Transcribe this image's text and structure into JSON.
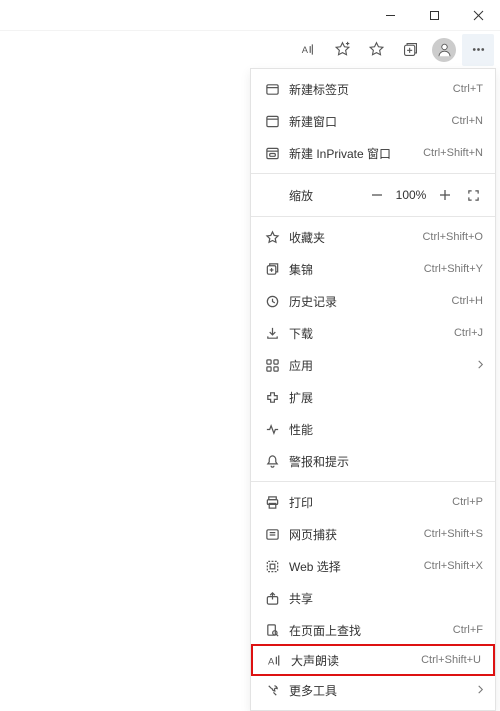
{
  "window": {
    "minimize": "–",
    "maximize": "□",
    "close": "×"
  },
  "menu": {
    "newTab": {
      "label": "新建标签页",
      "shortcut": "Ctrl+T"
    },
    "newWindow": {
      "label": "新建窗口",
      "shortcut": "Ctrl+N"
    },
    "newInPrivate": {
      "label": "新建 InPrivate 窗口",
      "shortcut": "Ctrl+Shift+N"
    },
    "zoom": {
      "label": "缩放",
      "value": "100%"
    },
    "favorites": {
      "label": "收藏夹",
      "shortcut": "Ctrl+Shift+O"
    },
    "collections": {
      "label": "集锦",
      "shortcut": "Ctrl+Shift+Y"
    },
    "history": {
      "label": "历史记录",
      "shortcut": "Ctrl+H"
    },
    "downloads": {
      "label": "下载",
      "shortcut": "Ctrl+J"
    },
    "apps": {
      "label": "应用"
    },
    "extensions": {
      "label": "扩展"
    },
    "performance": {
      "label": "性能"
    },
    "alerts": {
      "label": "警报和提示"
    },
    "print": {
      "label": "打印",
      "shortcut": "Ctrl+P"
    },
    "webCapture": {
      "label": "网页捕获",
      "shortcut": "Ctrl+Shift+S"
    },
    "webSelect": {
      "label": "Web 选择",
      "shortcut": "Ctrl+Shift+X"
    },
    "share": {
      "label": "共享"
    },
    "findOnPage": {
      "label": "在页面上查找",
      "shortcut": "Ctrl+F"
    },
    "readAloud": {
      "label": "大声朗读",
      "shortcut": "Ctrl+Shift+U"
    },
    "moreTools": {
      "label": "更多工具"
    }
  }
}
